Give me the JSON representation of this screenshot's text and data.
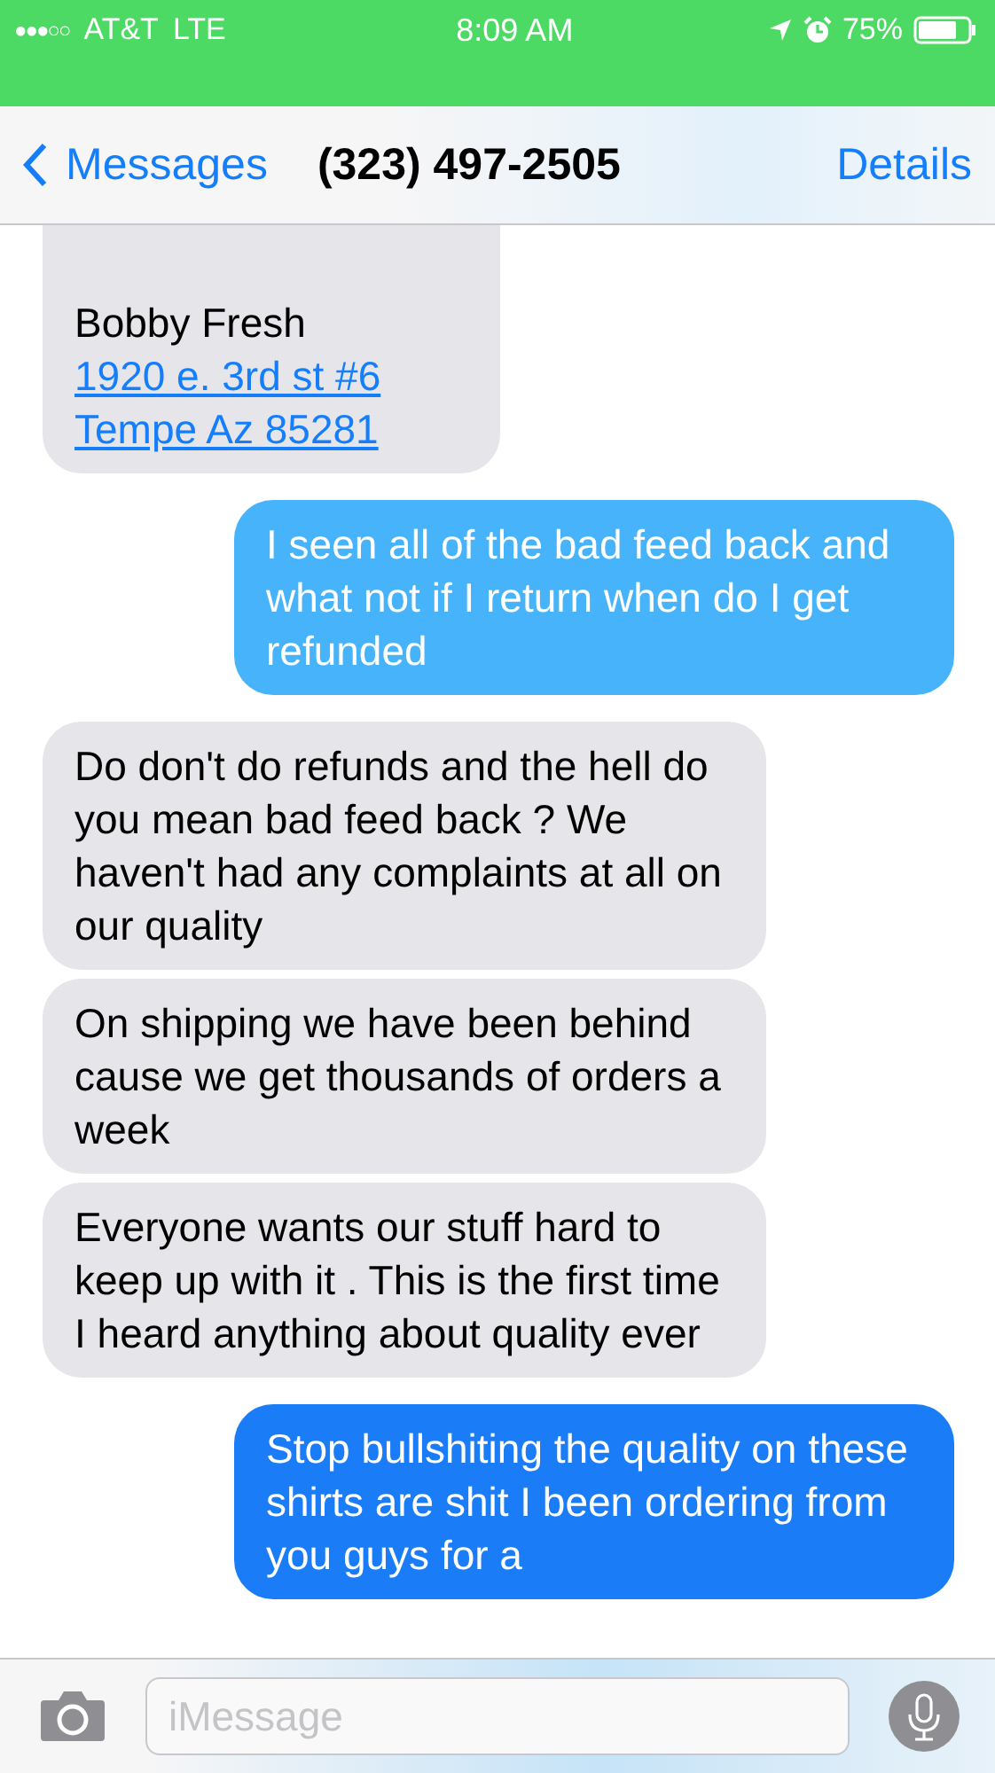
{
  "status_bar": {
    "signal_dots": "●●●○○",
    "carrier": "AT&T",
    "network": "LTE",
    "time": "8:09 AM",
    "battery": "75%"
  },
  "nav": {
    "back": "Messages",
    "title": "(323) 497-2505",
    "action": "Details"
  },
  "messages": [
    {
      "kind": "received",
      "lines": [
        {
          "kind": "text",
          "text": "Bobby Fresh"
        },
        {
          "kind": "link",
          "text": "1920 e. 3rd st #6"
        },
        {
          "kind": "link",
          "text": "Tempe Az 85281"
        }
      ]
    },
    {
      "kind": "sent",
      "color": "#47b3fa",
      "lines": [
        {
          "kind": "text",
          "text": "I seen all of the bad feed back and what not if I return when do I get refunded"
        }
      ]
    },
    {
      "kind": "received",
      "lines": [
        {
          "kind": "text",
          "text": "Do don't do refunds and the hell do you mean bad feed back ? We haven't had any complaints at all on our quality"
        }
      ]
    },
    {
      "kind": "received",
      "lines": [
        {
          "kind": "text",
          "text": "On shipping we have been behind cause we get thousands of orders a week"
        }
      ]
    },
    {
      "kind": "received",
      "lines": [
        {
          "kind": "text",
          "text": "Everyone wants our stuff hard to keep up with it . This is the first time I heard anything about quality ever"
        }
      ]
    },
    {
      "kind": "sent",
      "color": "#1a7cf6",
      "lines": [
        {
          "kind": "text",
          "text": "Stop bullshiting the quality on these shirts are shit I been ordering from you guys for a"
        }
      ]
    }
  ],
  "composer": {
    "placeholder": "iMessage"
  }
}
